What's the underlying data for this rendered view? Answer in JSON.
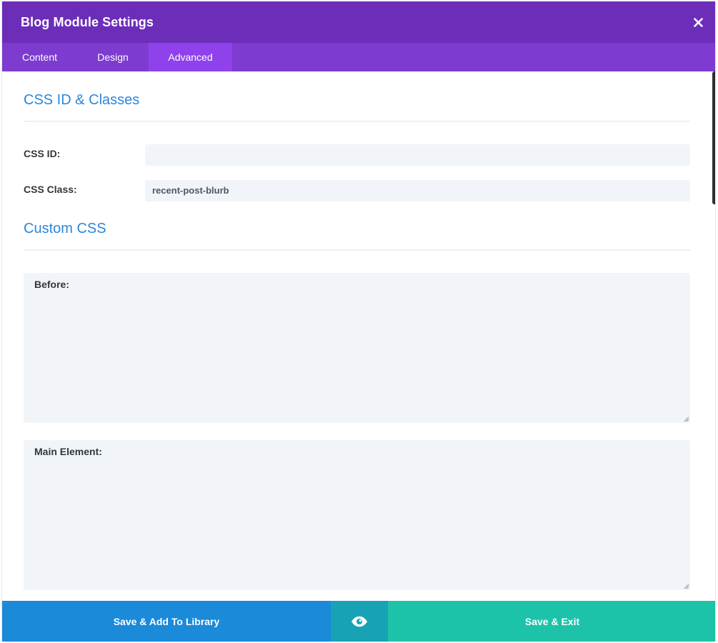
{
  "modal": {
    "title": "Blog Module Settings",
    "close_icon": "close-icon"
  },
  "tabs": [
    {
      "label": "Content",
      "active": false
    },
    {
      "label": "Design",
      "active": false
    },
    {
      "label": "Advanced",
      "active": true
    }
  ],
  "sections": {
    "css_id_classes": {
      "title": "CSS ID & Classes",
      "css_id_label": "CSS ID:",
      "css_id_value": "",
      "css_class_label": "CSS Class:",
      "css_class_value": "recent-post-blurb"
    },
    "custom_css": {
      "title": "Custom CSS",
      "before_label": "Before:",
      "main_element_label": "Main Element:"
    }
  },
  "footer": {
    "save_library_label": "Save & Add To Library",
    "preview_icon": "eye-icon",
    "save_exit_label": "Save & Exit"
  },
  "colors": {
    "header": "#6c2eb9",
    "tabs": "#7e3bd0",
    "active_tab": "#8f42ec",
    "section_title": "#2b87da",
    "save_library": "#1a8ad9",
    "preview": "#17a3b5",
    "save_exit": "#1cc3a9"
  }
}
